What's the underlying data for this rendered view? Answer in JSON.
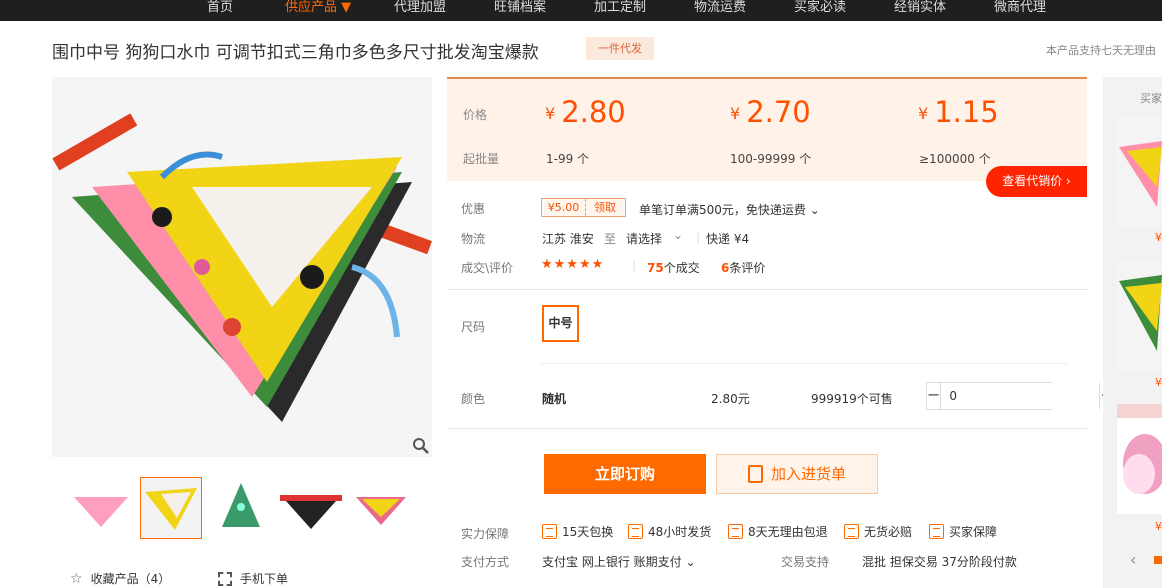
{
  "nav": {
    "items": [
      {
        "label": "首页",
        "active": false
      },
      {
        "label": "供应产品 ▼",
        "active": true
      },
      {
        "label": "代理加盟",
        "active": false
      },
      {
        "label": "旺铺档案",
        "active": false
      },
      {
        "label": "加工定制",
        "active": false
      },
      {
        "label": "物流运费",
        "active": false
      },
      {
        "label": "买家必读",
        "active": false
      },
      {
        "label": "经销实体",
        "active": false
      },
      {
        "label": "微商代理",
        "active": false
      }
    ]
  },
  "product": {
    "title": "围巾中号 狗狗口水巾 可调节扣式三角巾多色多尺寸批发淘宝爆款",
    "tag": "一件代发",
    "notice": "本产品支持七天无理由"
  },
  "pricing": {
    "price_label": "价格",
    "batch_label": "起批量",
    "currency": "¥",
    "tiers": [
      {
        "price": "2.80",
        "qty": "1-99 个"
      },
      {
        "price": "2.70",
        "qty": "100-99999 个"
      },
      {
        "price": "1.15",
        "qty": "≥100000 个"
      }
    ],
    "agent_button": "查看代销价 ›"
  },
  "promo": {
    "label": "优惠",
    "coupon_amount": "¥5.00",
    "coupon_claim": "领取",
    "text": "单笔订单满500元，免快递运费 ⌄"
  },
  "logistics": {
    "label": "物流",
    "origin": "江苏 淮安",
    "to": "至",
    "destination": "请选择",
    "shipping": "快递 ¥4"
  },
  "deals": {
    "label": "成交\\评价",
    "stars": "★★★★★",
    "deal_count": "75",
    "deal_suffix": "个成交",
    "review_count": "6",
    "review_suffix": "条评价"
  },
  "size": {
    "label": "尺码",
    "option": "中号"
  },
  "color": {
    "label": "颜色",
    "value": "随机",
    "price": "2.80元",
    "stock": "999919个可售",
    "quantity": "0"
  },
  "actions": {
    "buy": "立即订购",
    "cart": "加入进货单"
  },
  "guarantee": {
    "label": "实力保障",
    "items": [
      "15天包换",
      "48小时发货",
      "8天无理由包退",
      "无货必赔",
      "买家保障"
    ]
  },
  "payment": {
    "label": "支付方式",
    "methods": "支付宝   网上银行   账期支付   ⌄",
    "trade_label": "交易支持",
    "trade_items": "混批   担保交易   37分阶段付款"
  },
  "links": {
    "favorite": "收藏产品（4）",
    "mobile": "手机下单"
  },
  "sidebar": {
    "title": "买家",
    "price_mark": "¥"
  },
  "colors": {
    "accent": "#ff6a00",
    "price": "#ff5000",
    "nav_bg": "#1f1f1f"
  }
}
